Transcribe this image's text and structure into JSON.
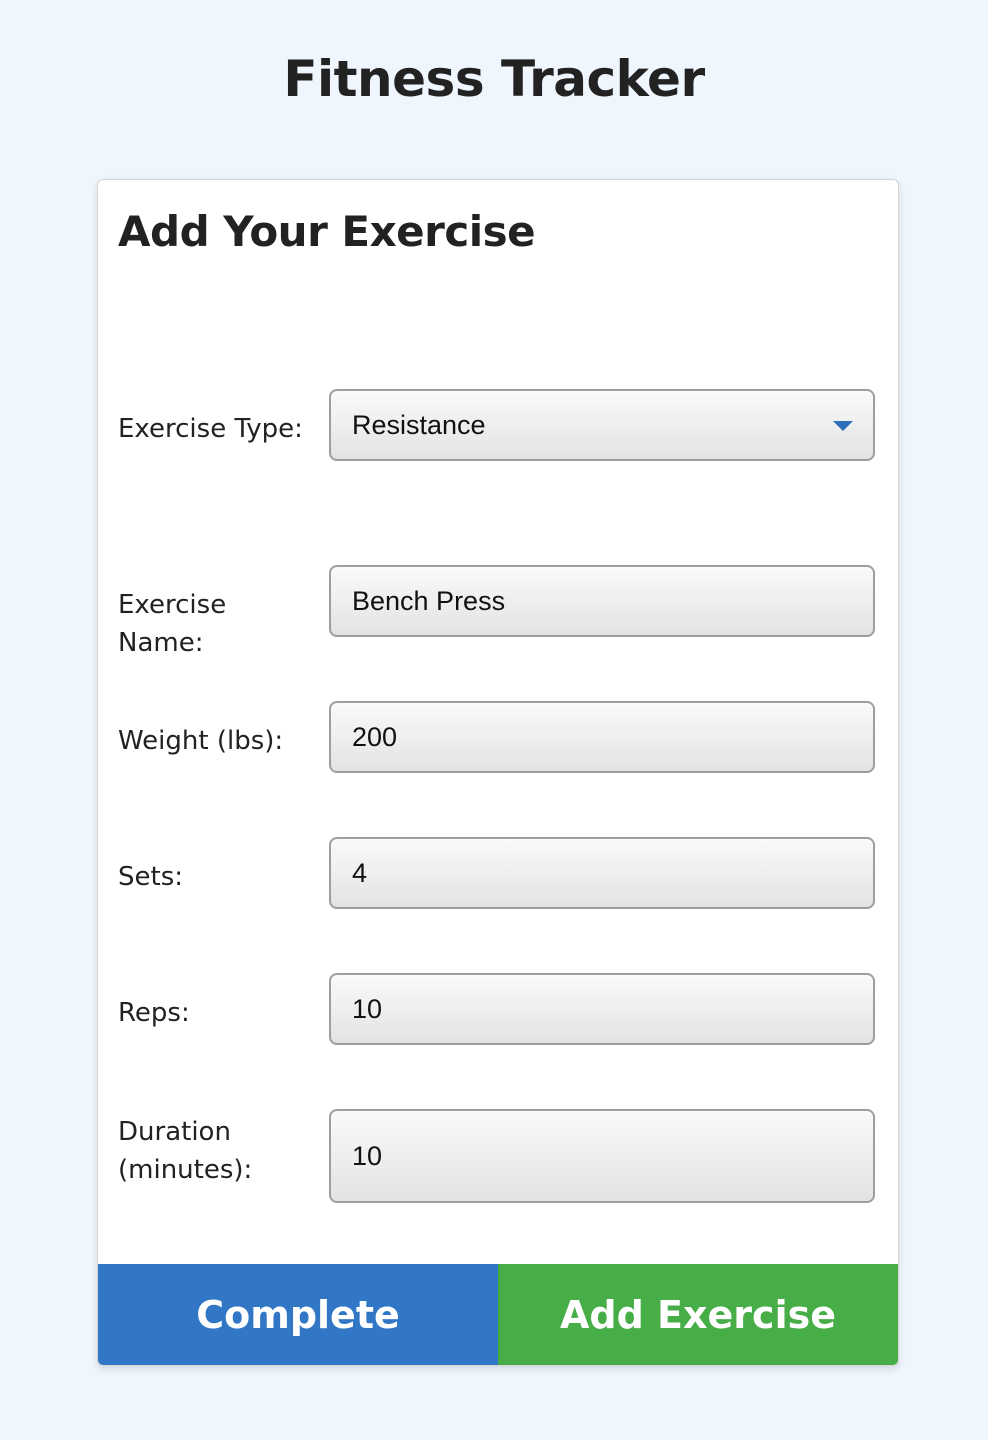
{
  "app": {
    "title": "Fitness Tracker"
  },
  "form": {
    "title": "Add Your Exercise",
    "exercise_type": {
      "label": "Exercise Type:",
      "value": "Resistance"
    },
    "exercise_name": {
      "label": "Exercise Name:",
      "value": "Bench Press"
    },
    "weight": {
      "label": "Weight (lbs):",
      "value": "200"
    },
    "sets": {
      "label": "Sets:",
      "value": "4"
    },
    "reps": {
      "label": "Reps:",
      "value": "10"
    },
    "duration": {
      "label_line1": "Duration",
      "label_line2": "(minutes):",
      "value": "10"
    }
  },
  "actions": {
    "complete_label": "Complete",
    "add_label": "Add Exercise"
  },
  "colors": {
    "page_background": "#eff6fe",
    "complete_button": "#3277c6",
    "add_button": "#47ad47",
    "select_arrow": "#2e6eb8"
  },
  "icons": {
    "select_arrow": "chevron-down-icon"
  }
}
